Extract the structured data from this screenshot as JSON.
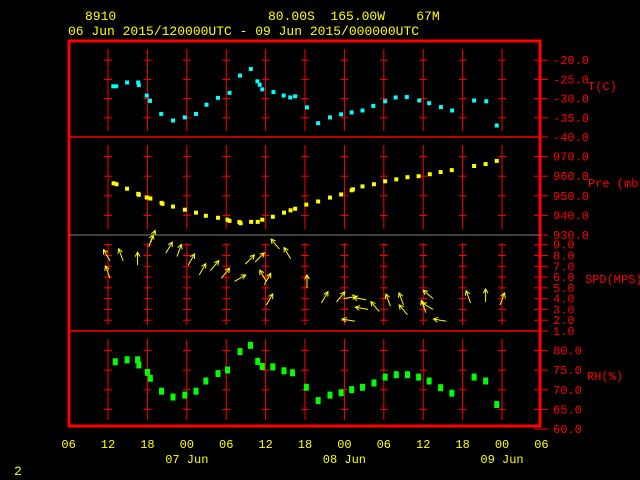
{
  "header": {
    "station": "8910",
    "location": "80.00S  165.00W    67M",
    "period": "06 Jun 2015/120000UTC - 09 Jun 2015/000000UTC"
  },
  "page_number": "2",
  "colors": {
    "frame": "#ff0000",
    "text": "#ffff00",
    "temp": "#00ffff",
    "pressure": "#ffff00",
    "wind": "#ffff00",
    "rh": "#00ff00",
    "divider_gray": "#808080"
  },
  "chart_data": {
    "type": "scatter",
    "title": "8910 80.00S 165.00W 67M",
    "x_units": "hours since 06 Jun 2015 06UTC",
    "xlim": [
      0,
      72
    ],
    "x_tick_labels": [
      "06",
      "12",
      "18",
      "00",
      "06",
      "12",
      "18",
      "00",
      "06",
      "12",
      "18",
      "00",
      "06"
    ],
    "date_labels": [
      {
        "hour": 18,
        "label": "07 Jun"
      },
      {
        "hour": 42,
        "label": "08 Jun"
      },
      {
        "hour": 66,
        "label": "09 Jun"
      }
    ],
    "panels": [
      {
        "name": "temperature",
        "ylabel": "T(C)",
        "ylim": [
          -40,
          -15
        ],
        "tick_labels": [
          "-20.0",
          "-25.0",
          "-30.0",
          "-35.0",
          "-40.0"
        ],
        "tick_values": [
          -20,
          -25,
          -30,
          -35,
          -40
        ],
        "points": [
          [
            6.8,
            -26.8
          ],
          [
            7.25,
            -26.8
          ],
          [
            8.9,
            -25.8
          ],
          [
            10.6,
            -25.8
          ],
          [
            10.7,
            -26.5
          ],
          [
            11.9,
            -29.2
          ],
          [
            12.4,
            -30.6
          ],
          [
            14.1,
            -34.0
          ],
          [
            15.9,
            -35.7
          ],
          [
            17.7,
            -34.9
          ],
          [
            19.4,
            -34.0
          ],
          [
            21.0,
            -31.6
          ],
          [
            22.75,
            -29.8
          ],
          [
            24.5,
            -28.5
          ],
          [
            26.1,
            -24.0
          ],
          [
            27.75,
            -22.3
          ],
          [
            28.75,
            -25.5
          ],
          [
            29.1,
            -26.4
          ],
          [
            29.5,
            -27.6
          ],
          [
            31.2,
            -28.3
          ],
          [
            32.75,
            -29.2
          ],
          [
            33.75,
            -29.7
          ],
          [
            34.5,
            -29.4
          ],
          [
            36.3,
            -32.3
          ],
          [
            38.0,
            -36.4
          ],
          [
            39.8,
            -34.9
          ],
          [
            41.5,
            -34.1
          ],
          [
            43.1,
            -33.6
          ],
          [
            44.75,
            -33.1
          ],
          [
            46.4,
            -31.9
          ],
          [
            48.2,
            -30.7
          ],
          [
            49.8,
            -29.7
          ],
          [
            51.5,
            -29.6
          ],
          [
            53.4,
            -30.5
          ],
          [
            54.9,
            -31.2
          ],
          [
            56.7,
            -32.2
          ],
          [
            58.4,
            -33.1
          ],
          [
            61.75,
            -30.5
          ],
          [
            63.6,
            -30.7
          ],
          [
            65.2,
            -37.0
          ]
        ]
      },
      {
        "name": "pressure",
        "ylabel": "Pre (mb)",
        "ylim": [
          930,
          980
        ],
        "tick_labels": [
          "970.0",
          "960.0",
          "950.0",
          "940.0",
          "930.0"
        ],
        "tick_values": [
          970,
          960,
          950,
          940,
          930
        ],
        "points": [
          [
            6.85,
            956.4
          ],
          [
            7.3,
            955.9
          ],
          [
            8.9,
            953.6
          ],
          [
            10.6,
            951.0
          ],
          [
            10.7,
            950.5
          ],
          [
            11.9,
            949.1
          ],
          [
            12.45,
            948.6
          ],
          [
            14.15,
            946.4
          ],
          [
            14.3,
            945.9
          ],
          [
            15.9,
            944.5
          ],
          [
            17.7,
            942.9
          ],
          [
            19.4,
            941.4
          ],
          [
            20.9,
            939.8
          ],
          [
            22.75,
            938.8
          ],
          [
            24.2,
            937.8
          ],
          [
            24.5,
            937.2
          ],
          [
            26.0,
            936.6
          ],
          [
            26.2,
            936.0
          ],
          [
            27.8,
            936.7
          ],
          [
            28.8,
            936.7
          ],
          [
            29.5,
            937.8
          ],
          [
            31.1,
            939.3
          ],
          [
            32.8,
            941.4
          ],
          [
            33.8,
            942.6
          ],
          [
            34.5,
            943.4
          ],
          [
            36.2,
            945.5
          ],
          [
            38.0,
            947.1
          ],
          [
            39.8,
            949.1
          ],
          [
            41.5,
            950.7
          ],
          [
            43.1,
            952.8
          ],
          [
            43.3,
            953.3
          ],
          [
            44.75,
            954.8
          ],
          [
            46.5,
            955.9
          ],
          [
            48.2,
            957.4
          ],
          [
            49.9,
            958.4
          ],
          [
            51.6,
            959.5
          ],
          [
            53.3,
            960.0
          ],
          [
            55.0,
            961.0
          ],
          [
            56.65,
            962.1
          ],
          [
            58.35,
            963.1
          ],
          [
            61.75,
            965.2
          ],
          [
            63.5,
            966.2
          ],
          [
            65.2,
            967.8
          ]
        ]
      },
      {
        "name": "wind",
        "ylabel": "SPD(MPS)",
        "ylim": [
          1,
          9.9
        ],
        "tick_labels": [
          "9.0",
          "8.0",
          "7.0",
          "6.0",
          "5.0",
          "4.0",
          "3.0",
          "2.0",
          "1.0"
        ],
        "tick_values": [
          9,
          8,
          7,
          6,
          5,
          4,
          3,
          2,
          1
        ],
        "points": [
          [
            6.3,
            7.5,
            330
          ],
          [
            6.3,
            5.9,
            340
          ],
          [
            8.3,
            7.5,
            340
          ],
          [
            10.5,
            7.1,
            0
          ],
          [
            12.2,
            8.8,
            20
          ],
          [
            12.5,
            9.2,
            20
          ],
          [
            14.8,
            8.2,
            30
          ],
          [
            16.5,
            7.9,
            20
          ],
          [
            18.2,
            7.1,
            30
          ],
          [
            19.9,
            6.2,
            30
          ],
          [
            21.6,
            6.6,
            40
          ],
          [
            23.25,
            5.9,
            40
          ],
          [
            25.25,
            5.6,
            60
          ],
          [
            26.9,
            7.2,
            45
          ],
          [
            28.4,
            7.4,
            45
          ],
          [
            29.8,
            5.3,
            30
          ],
          [
            30.1,
            5.6,
            330
          ],
          [
            30.1,
            3.4,
            30
          ],
          [
            32.1,
            8.6,
            320
          ],
          [
            33.8,
            7.7,
            330
          ],
          [
            36.3,
            5.0,
            0
          ],
          [
            38.5,
            3.6,
            30
          ],
          [
            40.8,
            3.7,
            40
          ],
          [
            41.9,
            4.0,
            80
          ],
          [
            43.6,
            1.9,
            280
          ],
          [
            45.3,
            3.9,
            280
          ],
          [
            45.6,
            3.0,
            280
          ],
          [
            47.3,
            2.8,
            320
          ],
          [
            49.0,
            3.3,
            340
          ],
          [
            51.0,
            3.4,
            340
          ],
          [
            51.6,
            2.5,
            320
          ],
          [
            54.4,
            2.7,
            340
          ],
          [
            55.5,
            4.0,
            310
          ],
          [
            55.5,
            3.0,
            300
          ],
          [
            57.5,
            1.9,
            280
          ],
          [
            61.2,
            3.6,
            340
          ],
          [
            63.5,
            3.7,
            0
          ],
          [
            65.7,
            3.4,
            20
          ]
        ]
      },
      {
        "name": "humidity",
        "ylabel": "RH(%)",
        "ylim": [
          60,
          85
        ],
        "tick_labels": [
          "80.0",
          "75.0",
          "70.0",
          "65.0",
          "60.0"
        ],
        "tick_values": [
          80,
          75,
          70,
          65,
          60
        ],
        "points": [
          [
            7.1,
            77.4
          ],
          [
            8.9,
            77.9
          ],
          [
            10.5,
            77.9
          ],
          [
            10.7,
            76.6
          ],
          [
            12.0,
            74.7
          ],
          [
            12.45,
            73.2
          ],
          [
            14.15,
            69.9
          ],
          [
            15.9,
            68.4
          ],
          [
            17.7,
            68.9
          ],
          [
            19.4,
            69.9
          ],
          [
            20.9,
            72.5
          ],
          [
            22.75,
            74.4
          ],
          [
            24.2,
            75.3
          ],
          [
            26.1,
            80.0
          ],
          [
            27.7,
            81.6
          ],
          [
            28.8,
            77.5
          ],
          [
            29.5,
            76.2
          ],
          [
            31.1,
            76.1
          ],
          [
            32.8,
            75.1
          ],
          [
            34.1,
            74.6
          ],
          [
            36.2,
            70.9
          ],
          [
            38.0,
            67.5
          ],
          [
            39.8,
            68.9
          ],
          [
            41.5,
            69.5
          ],
          [
            43.1,
            70.3
          ],
          [
            44.75,
            70.9
          ],
          [
            46.5,
            72.0
          ],
          [
            48.2,
            73.5
          ],
          [
            49.9,
            74.1
          ],
          [
            51.6,
            74.1
          ],
          [
            53.3,
            73.5
          ],
          [
            54.9,
            72.5
          ],
          [
            56.65,
            70.8
          ],
          [
            58.35,
            69.4
          ],
          [
            61.75,
            73.5
          ],
          [
            63.5,
            72.5
          ],
          [
            65.2,
            66.5
          ]
        ]
      }
    ]
  }
}
